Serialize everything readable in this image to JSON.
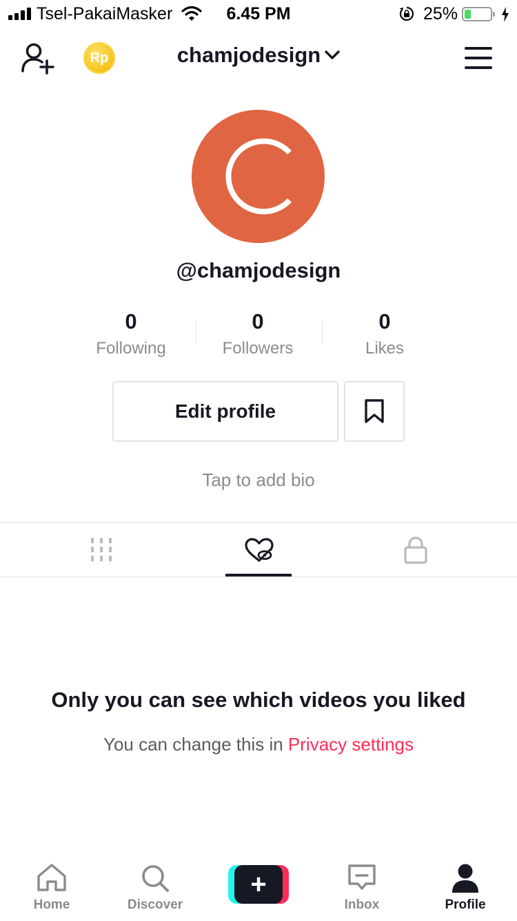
{
  "status_bar": {
    "carrier": "Tsel-PakaiMasker",
    "time": "6.45 PM",
    "battery_percent": "25%",
    "battery_level": 0.25,
    "icons": [
      "signal-icon",
      "wifi-icon",
      "rotation-lock-icon",
      "battery-icon",
      "charging-icon"
    ]
  },
  "header": {
    "username": "chamjodesign",
    "coin_label": "Rp",
    "icons": [
      "add-user-icon",
      "coin-icon",
      "chevron-down-icon",
      "menu-icon"
    ]
  },
  "profile": {
    "avatar_letter": "C",
    "handle": "@chamjodesign",
    "stats": [
      {
        "value": "0",
        "label": "Following"
      },
      {
        "value": "0",
        "label": "Followers"
      },
      {
        "value": "0",
        "label": "Likes"
      }
    ],
    "edit_profile_label": "Edit profile",
    "bio_placeholder": "Tap to add bio"
  },
  "tabs": [
    {
      "icon": "grid-icon",
      "active": false
    },
    {
      "icon": "liked-hidden-icon",
      "active": true
    },
    {
      "icon": "lock-icon",
      "active": false
    }
  ],
  "empty_state": {
    "title": "Only you can see which videos you liked",
    "subtitle_prefix": "You can change this in",
    "link": "Privacy settings"
  },
  "nav": {
    "items": [
      {
        "label": "Home",
        "icon": "home-icon"
      },
      {
        "label": "Discover",
        "icon": "search-icon"
      },
      {
        "label": "",
        "icon": "plus-icon"
      },
      {
        "label": "Inbox",
        "icon": "inbox-icon"
      },
      {
        "label": "Profile",
        "icon": "profile-icon",
        "active": true
      }
    ]
  },
  "colors": {
    "accent": "#fe2c55",
    "avatar": "#e06542",
    "text": "#161823",
    "muted": "#8a8b91",
    "cyan": "#25f4ee"
  }
}
